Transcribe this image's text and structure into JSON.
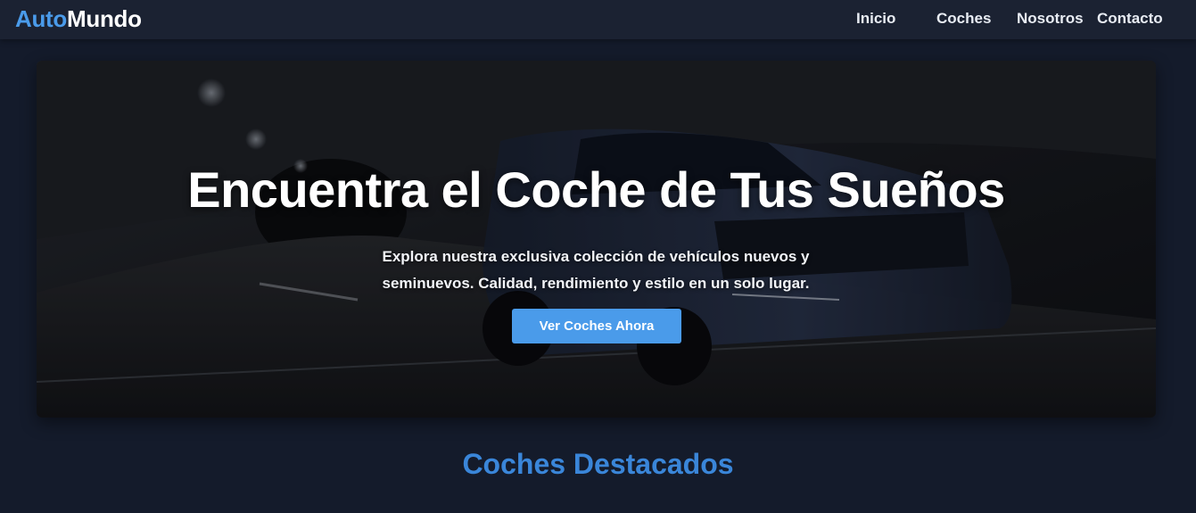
{
  "brand": {
    "part1": "Auto",
    "part2": "Mundo",
    "color1": "#4a9bea",
    "color2": "#ffffff"
  },
  "nav": {
    "links": [
      {
        "label": "Inicio"
      },
      {
        "label": "Coches"
      },
      {
        "label": "Nosotros"
      },
      {
        "label": "Contacto"
      }
    ]
  },
  "hero": {
    "title": "Encuentra el Coche de Tus Sueños",
    "subtitle": "Explora nuestra exclusiva colección de vehículos nuevos y seminuevos. Calidad, rendimiento y estilo en un solo lugar.",
    "cta_label": "Ver Coches Ahora",
    "background_image": "dark-sports-car-in-tunnel"
  },
  "featured": {
    "title": "Coches Destacados"
  },
  "colors": {
    "accent": "#4a9bea",
    "page_bg": "#141b2b",
    "nav_bg": "#1b2232"
  }
}
